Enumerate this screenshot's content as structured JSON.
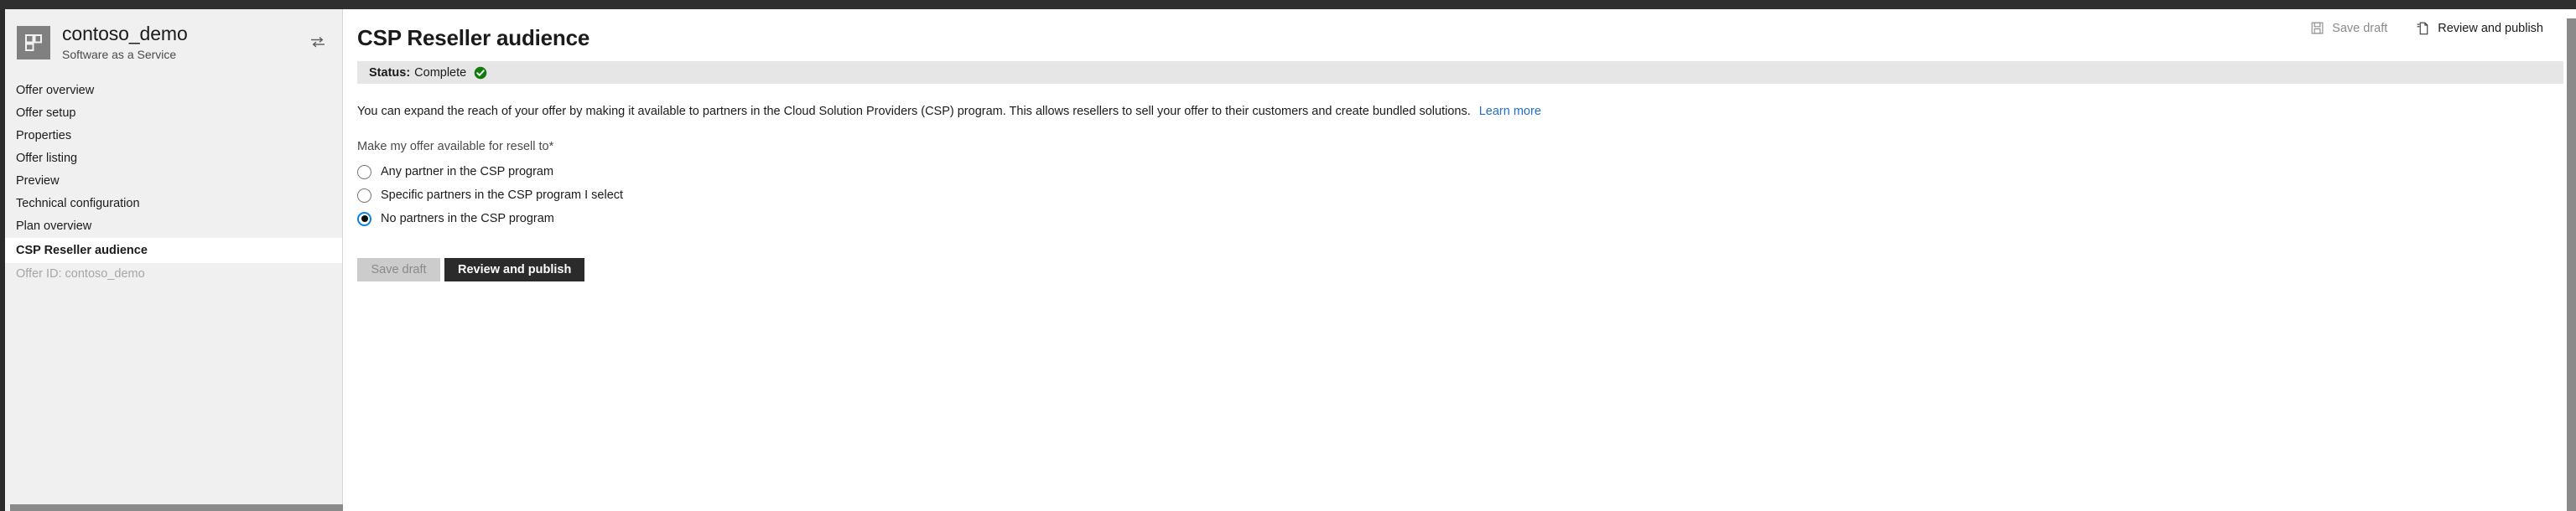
{
  "sidebar": {
    "brand": {
      "title": "contoso_demo",
      "subtitle": "Software as a Service",
      "logo_icon": "tiles-grid-icon",
      "switch_icon": "swap-arrows-icon"
    },
    "items": [
      {
        "label": "Offer overview",
        "selected": false
      },
      {
        "label": "Offer setup",
        "selected": false
      },
      {
        "label": "Properties",
        "selected": false
      },
      {
        "label": "Offer listing",
        "selected": false
      },
      {
        "label": "Preview",
        "selected": false
      },
      {
        "label": "Technical configuration",
        "selected": false
      },
      {
        "label": "Plan overview",
        "selected": false
      },
      {
        "label": "CSP Reseller audience",
        "selected": true
      }
    ],
    "footer": "Offer ID: contoso_demo"
  },
  "header": {
    "title": "CSP Reseller audience",
    "actions": [
      {
        "label": "Save draft",
        "icon": "save-floppy-icon",
        "enabled": false
      },
      {
        "label": "Review and publish",
        "icon": "document-publish-icon",
        "enabled": true
      }
    ]
  },
  "status": {
    "label": "Status:",
    "value": "Complete",
    "icon": "green-check-circle-icon",
    "color": "#107c10"
  },
  "main": {
    "intro_text": "You can expand the reach of your offer by making it available to partners in the Cloud Solution Providers (CSP) program. This allows resellers to sell your offer to their customers and create bundled solutions.",
    "learn_more": "Learn more",
    "field_label": "Make my offer available for resell to",
    "required_mark": "*",
    "options": [
      {
        "label": "Any partner in the CSP program",
        "checked": false
      },
      {
        "label": "Specific partners in the CSP program I select",
        "checked": false
      },
      {
        "label": "No partners in the CSP program",
        "checked": true
      }
    ],
    "buttons": {
      "save_draft": "Save draft",
      "review_publish": "Review and publish"
    }
  },
  "colors": {
    "accent_link": "#1f6fd0",
    "radio_selected_ring": "#0a84d8",
    "status_green": "#107c10",
    "primary_button_bg": "#2b2b2b"
  }
}
